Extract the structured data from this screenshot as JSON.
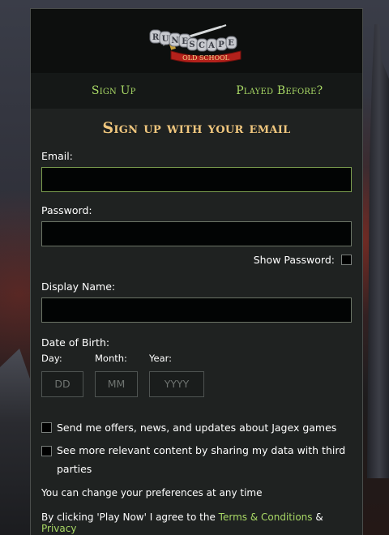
{
  "logo": {
    "runes": [
      "R",
      "U",
      "N",
      "E",
      "S",
      "C",
      "A",
      "P",
      "E"
    ],
    "banner": "OLD SCHOOL"
  },
  "tabs": {
    "sign_up": "Sign Up",
    "played_before": "Played Before?"
  },
  "heading": "Sign up with your email",
  "fields": {
    "email_label": "Email:",
    "password_label": "Password:",
    "show_password_label": "Show Password:",
    "display_name_label": "Display Name:",
    "dob_label": "Date of Birth:",
    "day_label": "Day:",
    "day_placeholder": "DD",
    "month_label": "Month:",
    "month_placeholder": "MM",
    "year_label": "Year:",
    "year_placeholder": "YYYY"
  },
  "consent": {
    "offers": "Send me offers, news, and updates about Jagex games",
    "relevant_line1": "See more relevant content by sharing my data with third",
    "relevant_line2": "parties",
    "preferences_note": "You can change your preferences at any time",
    "agree_prefix": "By clicking 'Play Now' I agree to the ",
    "terms_link": "Terms & Conditions",
    "amp": " & ",
    "privacy_link": "Privacy"
  },
  "colors": {
    "accent_green": "#a8d865",
    "heading_gold": "#f0c77e",
    "panel_bg": "#1f2221"
  }
}
